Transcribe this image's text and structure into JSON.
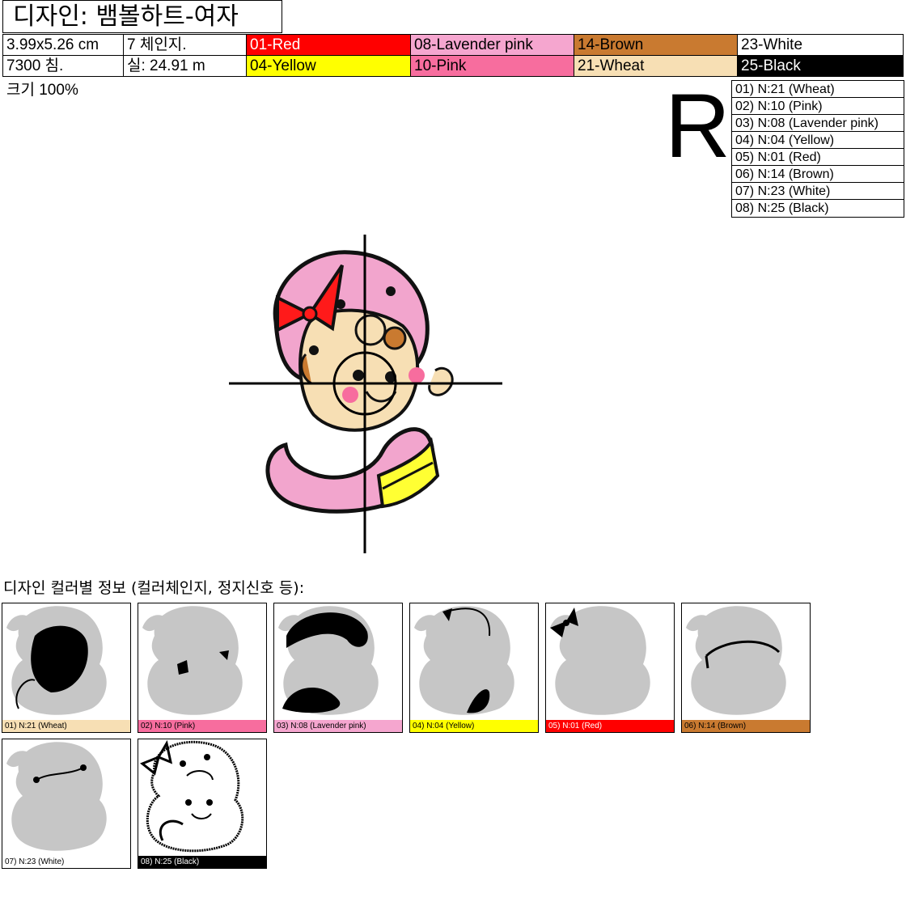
{
  "title": "디자인: 뱀볼하트-여자",
  "info": {
    "size": "3.99x5.26 cm",
    "color_changes": "7 체인지.",
    "stitches": "7300 침.",
    "thread_length": "실: 24.91 m"
  },
  "colors": [
    {
      "label": "01-Red",
      "hex": "#ff0000",
      "text": "#ffffff"
    },
    {
      "label": "08-Lavender pink",
      "hex": "#f5a6cf",
      "text": "#000000"
    },
    {
      "label": "14-Brown",
      "hex": "#c97a30",
      "text": "#000000"
    },
    {
      "label": "23-White",
      "hex": "#ffffff",
      "text": "#000000"
    },
    {
      "label": "04-Yellow",
      "hex": "#ffff00",
      "text": "#000000"
    },
    {
      "label": "10-Pink",
      "hex": "#f76d9e",
      "text": "#000000"
    },
    {
      "label": "21-Wheat",
      "hex": "#f7dfb4",
      "text": "#000000"
    },
    {
      "label": "25-Black",
      "hex": "#000000",
      "text": "#ffffff"
    }
  ],
  "scale": "크기 100%",
  "rotation_mark": "R",
  "sequence": [
    "01) N:21 (Wheat)",
    "02) N:10 (Pink)",
    "03) N:08 (Lavender pink)",
    "04) N:04 (Yellow)",
    "05) N:01 (Red)",
    "06) N:14 (Brown)",
    "07) N:23 (White)",
    "08) N:25 (Black)"
  ],
  "section_title": "디자인 컬러별 정보 (컬러체인지, 정지신호 등):",
  "thumbnails": [
    {
      "caption": "01) N:21 (Wheat)",
      "hex": "#f7dfb4",
      "text": "#000000"
    },
    {
      "caption": "02) N:10 (Pink)",
      "hex": "#f76d9e",
      "text": "#000000"
    },
    {
      "caption": "03) N:08 (Lavender pink)",
      "hex": "#f5a6cf",
      "text": "#000000"
    },
    {
      "caption": "04) N:04 (Yellow)",
      "hex": "#ffff00",
      "text": "#000000"
    },
    {
      "caption": "05) N:01 (Red)",
      "hex": "#ff0000",
      "text": "#ffffff"
    },
    {
      "caption": "06) N:14 (Brown)",
      "hex": "#c97a30",
      "text": "#000000"
    },
    {
      "caption": "07) N:23 (White)",
      "hex": "#ffffff",
      "text": "#000000"
    },
    {
      "caption": "08) N:25 (Black)",
      "hex": "#000000",
      "text": "#ffffff"
    }
  ]
}
